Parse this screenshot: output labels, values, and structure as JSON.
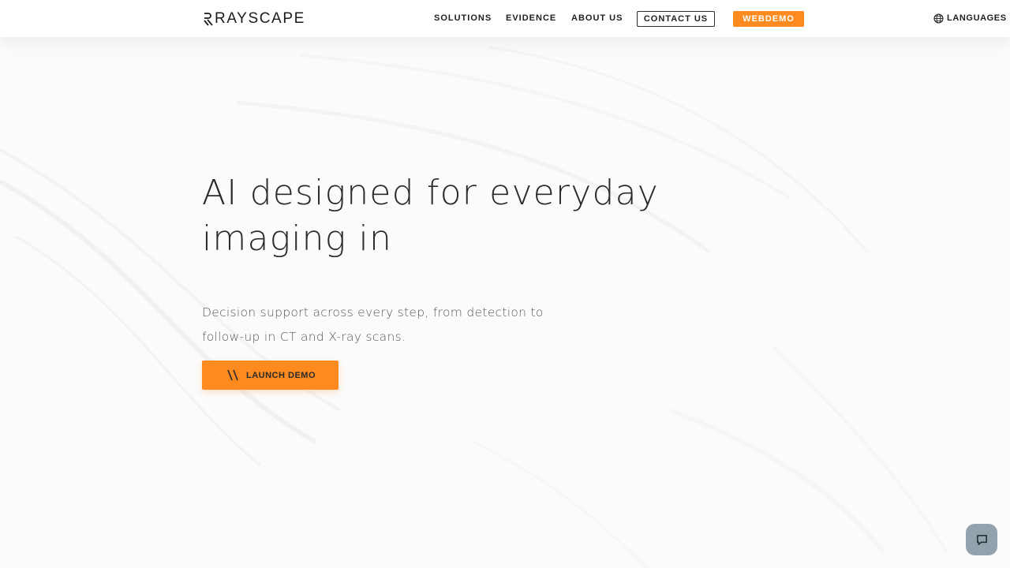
{
  "brand": {
    "name": "RAYSCAPE",
    "accent_color": "#ff8a1f"
  },
  "nav": {
    "items": [
      {
        "label": "SOLUTIONS"
      },
      {
        "label": "EVIDENCE"
      },
      {
        "label": "ABOUT US"
      }
    ],
    "contact_label": "CONTACT US",
    "webdemo_label": "WEBDEMO",
    "languages_label": "LANGUAGES",
    "languages_icon": "globe-icon"
  },
  "hero": {
    "title": "AI designed for everyday imaging in",
    "subtitle": "Decision support across every step, from detection to follow-up in CT and X-ray scans.",
    "cta_label": "LAUNCH DEMO",
    "cta_icon": "double-slash-icon"
  },
  "chat": {
    "icon": "chat-bubble-icon",
    "color": "#93a3ad"
  }
}
